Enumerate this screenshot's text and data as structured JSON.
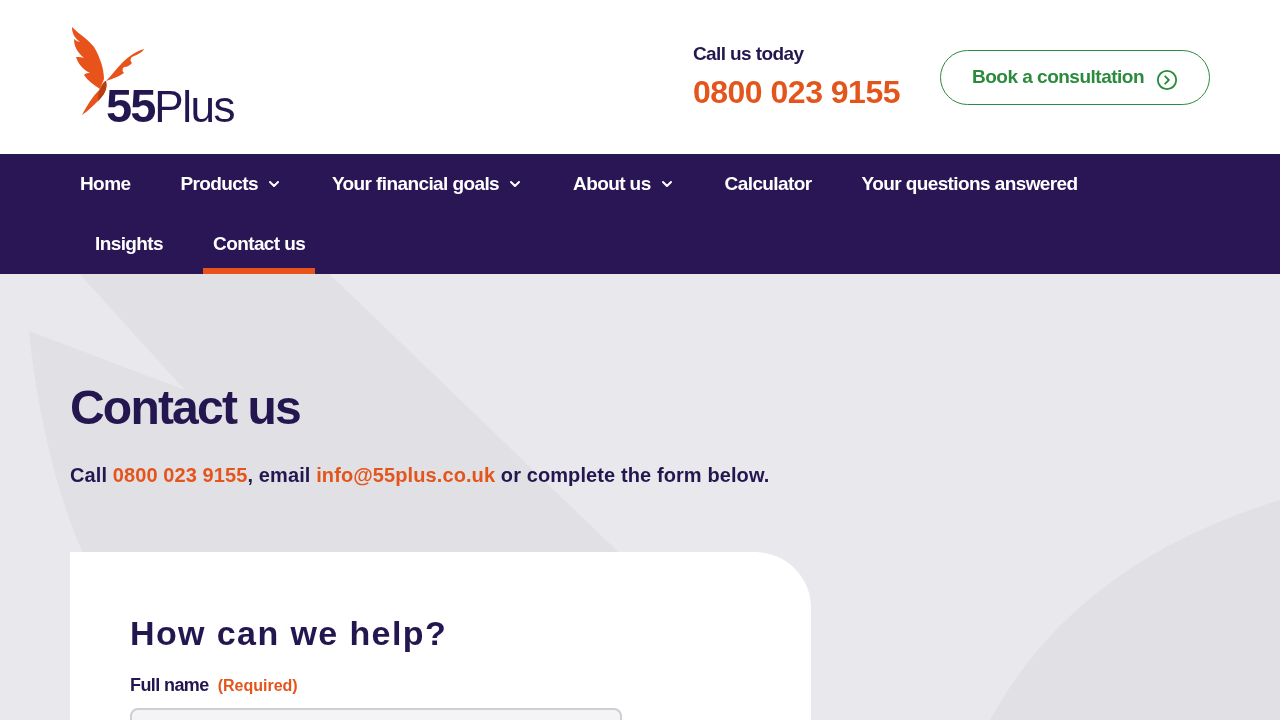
{
  "header": {
    "logo": {
      "bold": "55",
      "light": "Plus"
    },
    "call_label": "Call us today",
    "phone": "0800 023 9155",
    "cta": "Book a consultation"
  },
  "nav": {
    "rows": [
      [
        {
          "label": "Home",
          "dropdown": false,
          "selected": false
        },
        {
          "label": "Products",
          "dropdown": true,
          "selected": false
        },
        {
          "label": "Your financial goals",
          "dropdown": true,
          "selected": false
        },
        {
          "label": "About us",
          "dropdown": true,
          "selected": false
        },
        {
          "label": "Calculator",
          "dropdown": false,
          "selected": false
        },
        {
          "label": "Your questions answered",
          "dropdown": false,
          "selected": false
        }
      ],
      [
        {
          "label": "Insights",
          "dropdown": false,
          "selected": false
        },
        {
          "label": "Contact us",
          "dropdown": false,
          "selected": true
        }
      ]
    ]
  },
  "hero": {
    "title": "Contact us",
    "intro": [
      {
        "kind": "text",
        "text": "Call "
      },
      {
        "kind": "phone",
        "text": "0800 023 9155"
      },
      {
        "kind": "text",
        "text": ", email "
      },
      {
        "kind": "email",
        "text": "info@55plus.co.uk"
      },
      {
        "kind": "text",
        "text": " or complete the form below."
      }
    ]
  },
  "form": {
    "title": "How can we help?",
    "fields": [
      {
        "label": "Full name",
        "required_note": "(Required)"
      }
    ]
  }
}
